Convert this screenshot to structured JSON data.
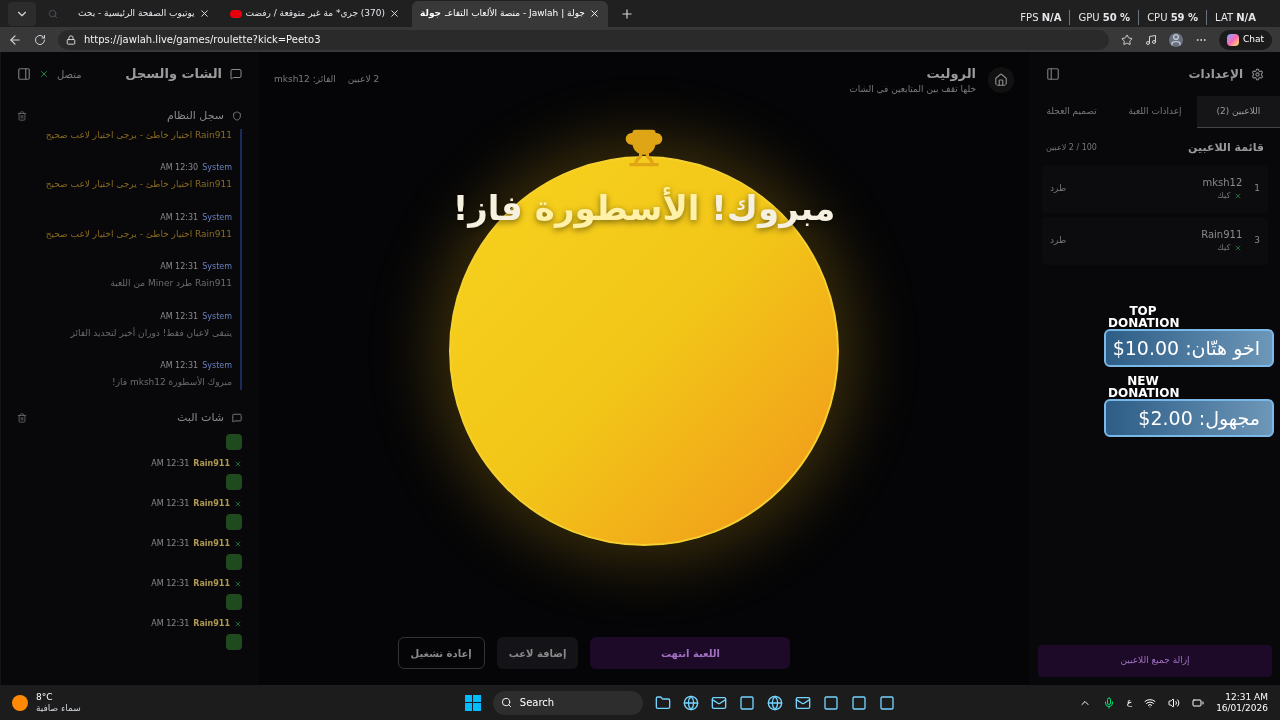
{
  "browser": {
    "tabs": [
      {
        "title": "جولة | Jawlah - منصة الألعاب التفاعـ",
        "favicon_text": "جولة",
        "selected": true
      },
      {
        "title": "(370) جري* مة غير متوقعة / رفضت",
        "selected": false
      },
      {
        "title": "يوتيوب الصفحة الرئيسية - بحث",
        "selected": false
      }
    ],
    "perf": [
      "LAT **N/A**",
      "CPU **59 %**",
      "GPU **50 %**",
      "FPS **N/A**"
    ],
    "url": "https://jawlah.live/games/roulette?kick=Peeto3",
    "chat_button": "Chat"
  },
  "chat_panel": {
    "title": "الشات والسجل",
    "status": "متصل",
    "log_title": "سجل النظام",
    "log": [
      {
        "kind": "plain",
        "message": "Rain911 اختيار خاطئ - يرجى اختيار لاعب صحيح",
        "color": "#8a6a1e"
      },
      {
        "kind": "meta",
        "sender": "System",
        "time": "12:30 AM",
        "message": "Rain911 اختيار خاطئ - يرجى اختيار لاعب صحيح",
        "color": "#8a6a1e"
      },
      {
        "kind": "meta",
        "sender": "System",
        "time": "12:31 AM",
        "message": "Rain911 اختيار خاطئ - يرجى اختيار لاعب صحيح",
        "color": "#8a6a1e"
      },
      {
        "kind": "meta",
        "sender": "System",
        "time": "12:31 AM",
        "message": "Rain911 طرد Miner من اللعبة",
        "color": "#6b6b6b"
      },
      {
        "kind": "meta",
        "sender": "System",
        "time": "12:31 AM",
        "message": "يتبقى لاعبان فقط! دوران أخير لتحديد الفائز",
        "color": "#6b6b6b"
      },
      {
        "kind": "meta",
        "sender": "System",
        "time": "12:31 AM",
        "message": "مبروك الأسطورة mksh12 فاز!",
        "color": "#6b6b6b"
      }
    ],
    "stream_title": "شات البث",
    "stream": [
      {
        "kind": "emote"
      },
      {
        "kind": "message",
        "user": "Rain911",
        "time": "12:31 AM"
      },
      {
        "kind": "message",
        "user": "Rain911",
        "time": "12:31 AM"
      },
      {
        "kind": "message",
        "user": "Rain911",
        "time": "12:31 AM"
      },
      {
        "kind": "message",
        "user": "Rain911",
        "time": "12:31 AM"
      },
      {
        "kind": "message",
        "user": "Rain911",
        "time": "12:31 AM"
      }
    ]
  },
  "game": {
    "title": "الروليت",
    "subtitle": "خلها تقف بين المتابعين في الشات",
    "players_count": "2 لاعبين",
    "winner": "الفائز: mksh12",
    "banner": {
      "before": "مبروك!",
      "name": "الأسطورة",
      "after": "فاز!"
    },
    "buttons": [
      {
        "label": "اللعبة انتهت",
        "kind": "primary"
      },
      {
        "label": "إضافة لاعب",
        "kind": "secondary"
      },
      {
        "label": "إعادة تشغيل",
        "kind": "outline"
      }
    ]
  },
  "settings": {
    "title": "الإعدادات",
    "tabs": [
      {
        "label": "اللاعبين (2)",
        "selected": true
      },
      {
        "label": "إعدادات اللعبة",
        "selected": false
      },
      {
        "label": "تصميم العجلة",
        "selected": false
      }
    ],
    "list_title": "قائمة اللاعبين",
    "list_count": "100 / 2 لاعبين",
    "players": [
      {
        "rank": "1",
        "name": "mksh12",
        "platform": "كيك",
        "action": "طرد"
      },
      {
        "rank": "3",
        "name": "Rain911",
        "platform": "كيك",
        "action": "طرد"
      }
    ],
    "clear_button": "إزالة جميع اللاعبين"
  },
  "donations": [
    {
      "heading": "TOP DONATION",
      "text": "اخو هتّان: 10.00$"
    },
    {
      "heading": "NEW DONATION",
      "text": "مجهول: 2.00$"
    }
  ],
  "taskbar": {
    "temperature": "8°C",
    "weather": "سماء صافية",
    "search": "Search",
    "language": "ع",
    "time": "12:31 AM",
    "date": "16/01/2026"
  }
}
